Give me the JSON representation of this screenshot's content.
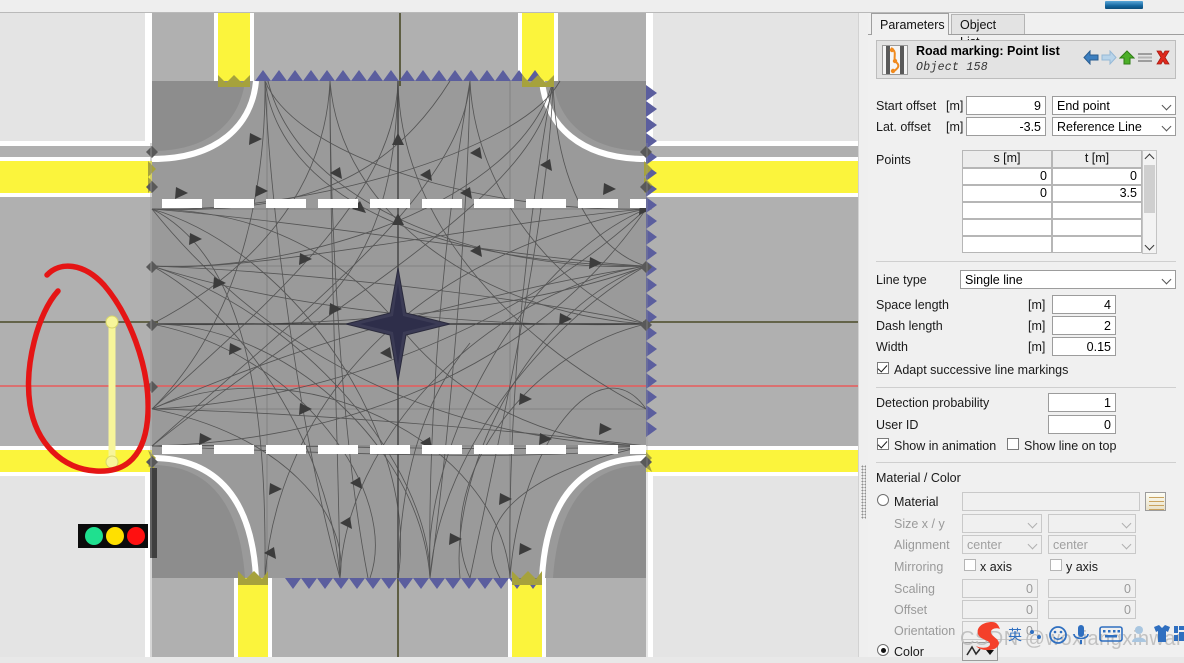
{
  "tabs": [
    {
      "id": "parameters",
      "label": "Parameters",
      "active": true
    },
    {
      "id": "object-list",
      "label": "Object List",
      "active": false
    }
  ],
  "object_header": {
    "title": "Road marking: Point list",
    "subtitle": "Object  158",
    "icon": "road-marking-icon",
    "actions": [
      {
        "name": "previous-object-icon",
        "glyph": "arrow-left",
        "color": "#2f6fb5"
      },
      {
        "name": "next-object-icon",
        "glyph": "arrow-right",
        "color": "#a8c8e4"
      },
      {
        "name": "move-up-icon",
        "glyph": "arrow-up",
        "color": "#4aa832"
      },
      {
        "name": "list-icon",
        "glyph": "lines",
        "color": "#909090"
      },
      {
        "name": "delete-icon",
        "glyph": "x",
        "color": "#e02b20"
      }
    ]
  },
  "offsets": {
    "start_offset_label": "Start offset",
    "start_offset_unit": "[m]",
    "start_offset_value": "9",
    "lat_offset_label": "Lat. offset",
    "lat_offset_unit": "[m]",
    "lat_offset_value": "-3.5",
    "reference_point_value": "End point",
    "reference_line_value": "Reference Line"
  },
  "points": {
    "label": "Points",
    "columns": [
      "s [m]",
      "t [m]"
    ],
    "rows": [
      {
        "s": "0",
        "t": "0"
      },
      {
        "s": "0",
        "t": "3.5"
      },
      {
        "s": "",
        "t": ""
      },
      {
        "s": "",
        "t": ""
      },
      {
        "s": "",
        "t": ""
      }
    ]
  },
  "line": {
    "line_type_label": "Line type",
    "line_type_value": "Single line",
    "space_length_label": "Space length",
    "space_length_unit": "[m]",
    "space_length_value": "4",
    "dash_length_label": "Dash length",
    "dash_length_unit": "[m]",
    "dash_length_value": "2",
    "width_label": "Width",
    "width_unit": "[m]",
    "width_value": "0.15",
    "adapt_label": "Adapt successive line markings",
    "adapt_checked": true
  },
  "detection": {
    "probability_label": "Detection probability",
    "probability_value": "1",
    "user_id_label": "User ID",
    "user_id_value": "0",
    "show_in_animation_label": "Show in animation",
    "show_in_animation_checked": true,
    "show_line_on_top_label": "Show line on top",
    "show_line_on_top_checked": false
  },
  "material": {
    "section_label": "Material / Color",
    "material_radio_label": "Material",
    "material_selected": false,
    "material_value": "",
    "size_label": "Size x / y",
    "size_x_value": "",
    "size_y_value": "",
    "alignment_label": "Alignment",
    "alignment_x_value": "center",
    "alignment_y_value": "center",
    "mirroring_label": "Mirroring",
    "mirror_x_label": "x axis",
    "mirror_x_checked": false,
    "mirror_y_label": "y axis",
    "mirror_y_checked": false,
    "scaling_label": "Scaling",
    "scaling_x_value": "0",
    "scaling_y_value": "0",
    "offset_label": "Offset",
    "offset_x_value": "0",
    "offset_y_value": "0",
    "orientation_label": "Orientation",
    "orientation_value": "0",
    "color_radio_label": "Color",
    "color_selected": true
  },
  "overlay": {
    "watermark": "CSDN @woxiangxinwang",
    "ime_items": [
      "sogou-logo-icon",
      "chinese-english-toggle-icon",
      "punctuation-icon",
      "emoji-icon",
      "voice-input-icon",
      "keyboard-icon",
      "user-icon",
      "skin-icon",
      "apps-icon"
    ]
  },
  "map": {
    "background_color": "#e4e4e4",
    "road_color": "#b0b0b0",
    "intersection_color": "#9a9a9a",
    "median_color": "#fbf43c",
    "marking_color": "#ffffff",
    "boundary_zigzag_color": "#5b5e9e",
    "reference_line_color": "#e85b5b",
    "selected_marking_color": "#f7f59a",
    "annotation_color": "#e51515",
    "traffic_light": {
      "name": "traffic-light",
      "lights": [
        "#1fe08f",
        "#ffe000",
        "#ff1010"
      ]
    },
    "arrows_color": "#4a4a4a"
  }
}
